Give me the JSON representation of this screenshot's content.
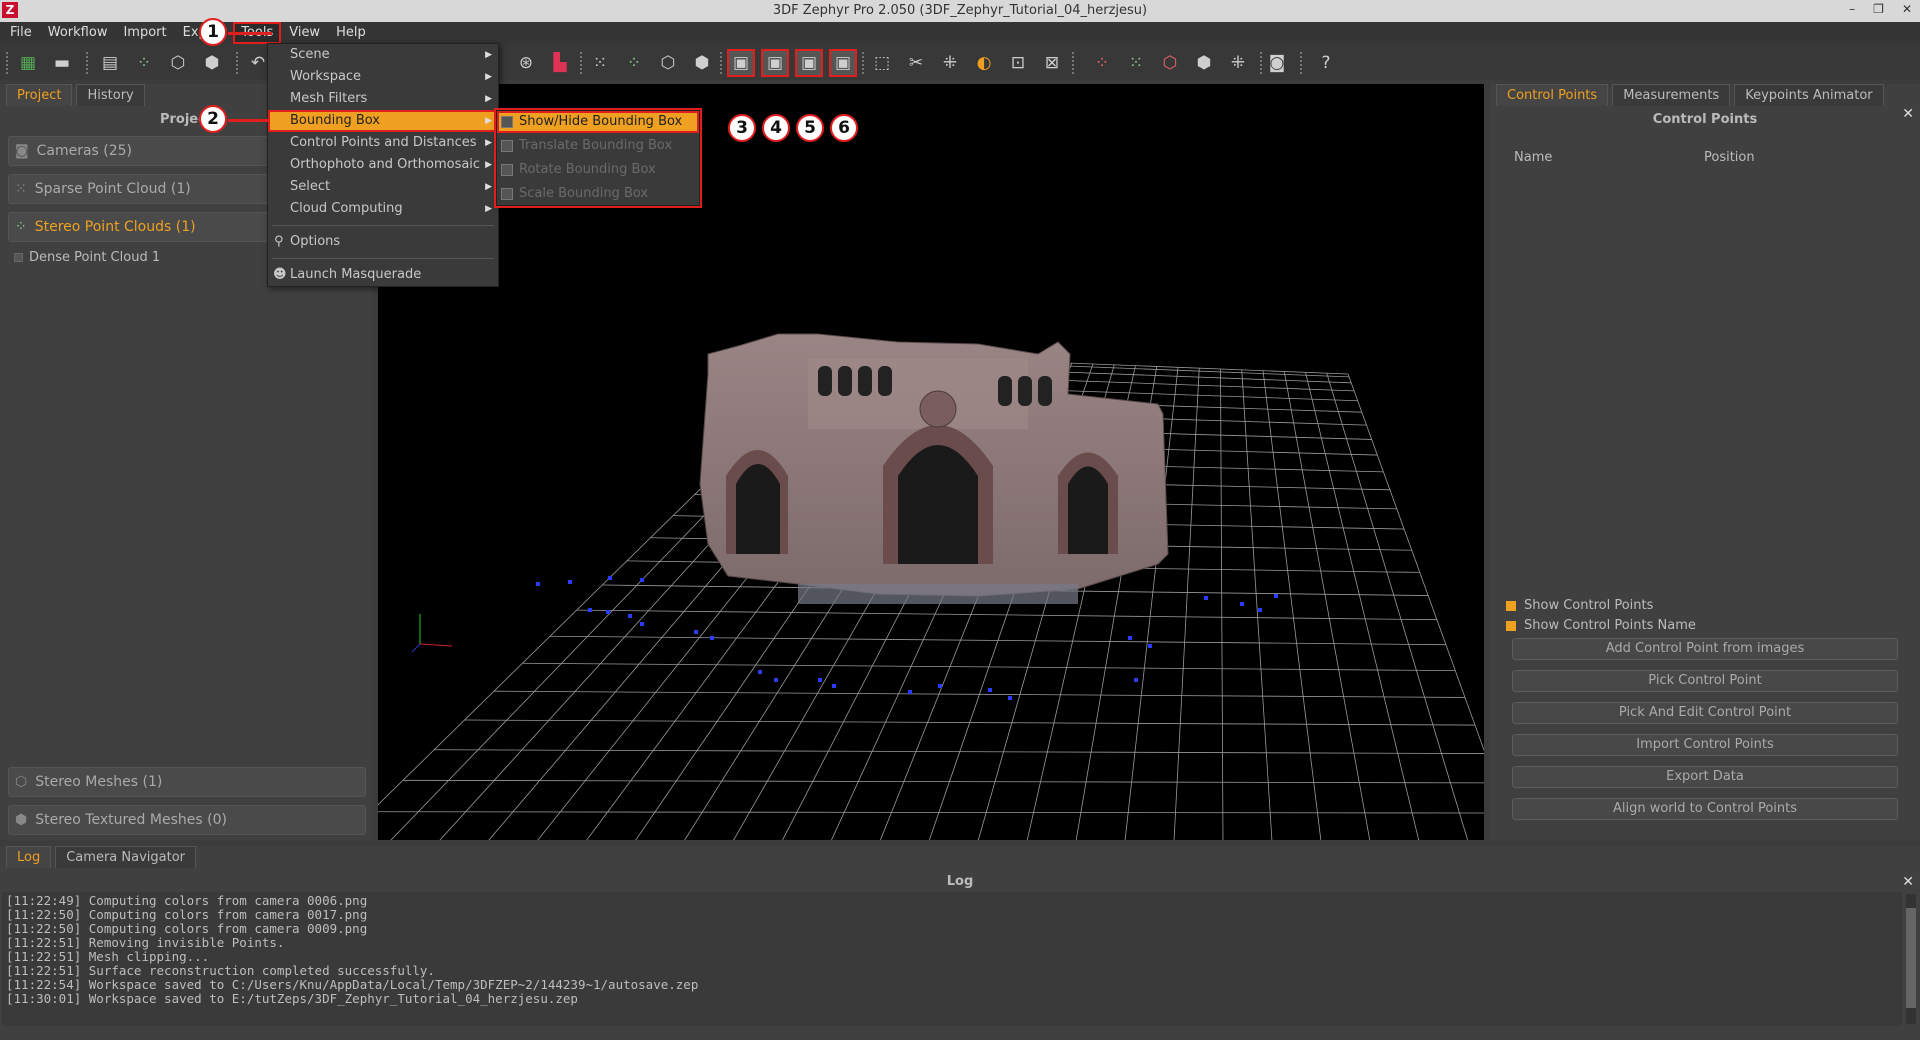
{
  "window": {
    "title": "3DF Zephyr Pro 2.050 (3DF_Zephyr_Tutorial_04_herzjesu)",
    "logo": "Z",
    "buttons": [
      "–",
      "❐",
      "✕"
    ]
  },
  "menubar": [
    "File",
    "Workflow",
    "Import",
    "Export",
    "Tools",
    "View",
    "Help"
  ],
  "badges": [
    "1",
    "2",
    "3",
    "4",
    "5",
    "6"
  ],
  "tools_menu": {
    "items": [
      "Scene",
      "Workspace",
      "Mesh Filters",
      "Bounding Box",
      "Control Points and Distances",
      "Orthophoto and Orthomosaic",
      "Select",
      "Cloud Computing"
    ],
    "options": "Options",
    "masquerade": "Launch Masquerade"
  },
  "bbox_submenu": [
    "Show/Hide Bounding Box",
    "Translate Bounding Box",
    "Rotate Bounding Box",
    "Scale Bounding Box"
  ],
  "left_panel": {
    "tabs": [
      "Project",
      "History"
    ],
    "header": "Project",
    "sections": [
      "Cameras (25)",
      "Sparse Point Cloud (1)",
      "Stereo Point Clouds (1)",
      "Stereo Meshes (1)",
      "Stereo Textured Meshes (0)"
    ],
    "subitem": "Dense Point Cloud 1"
  },
  "right_panel": {
    "tabs": [
      "Control Points",
      "Measurements",
      "Keypoints Animator"
    ],
    "title": "Control Points",
    "columns": [
      "Name",
      "Position"
    ],
    "checks": [
      "Show Control Points",
      "Show Control Points Name"
    ],
    "buttons": [
      "Add Control Point from images",
      "Pick Control Point",
      "Pick And Edit Control Point",
      "Import Control Points",
      "Export Data",
      "Align world to Control Points"
    ]
  },
  "bottom": {
    "tabs": [
      "Log",
      "Camera Navigator"
    ],
    "title": "Log",
    "lines": [
      "[11:22:49] Computing colors from camera 0006.png",
      "[11:22:50] Computing colors from camera 0017.png",
      "[11:22:50] Computing colors from camera 0009.png",
      "[11:22:51] Removing invisible Points.",
      "[11:22:51] Mesh clipping...",
      "[11:22:51] Surface reconstruction completed successfully.",
      "[11:22:54] Workspace saved to C:/Users/Knu/AppData/Local/Temp/3DFZEP~2/144239~1/autosave.zep",
      "[11:30:01] Workspace saved to E:/tutZeps/3DF_Zephyr_Tutorial_04_herzjesu.zep"
    ]
  },
  "colors": {
    "accent": "#f0a020",
    "highlight": "#e01e1e"
  }
}
